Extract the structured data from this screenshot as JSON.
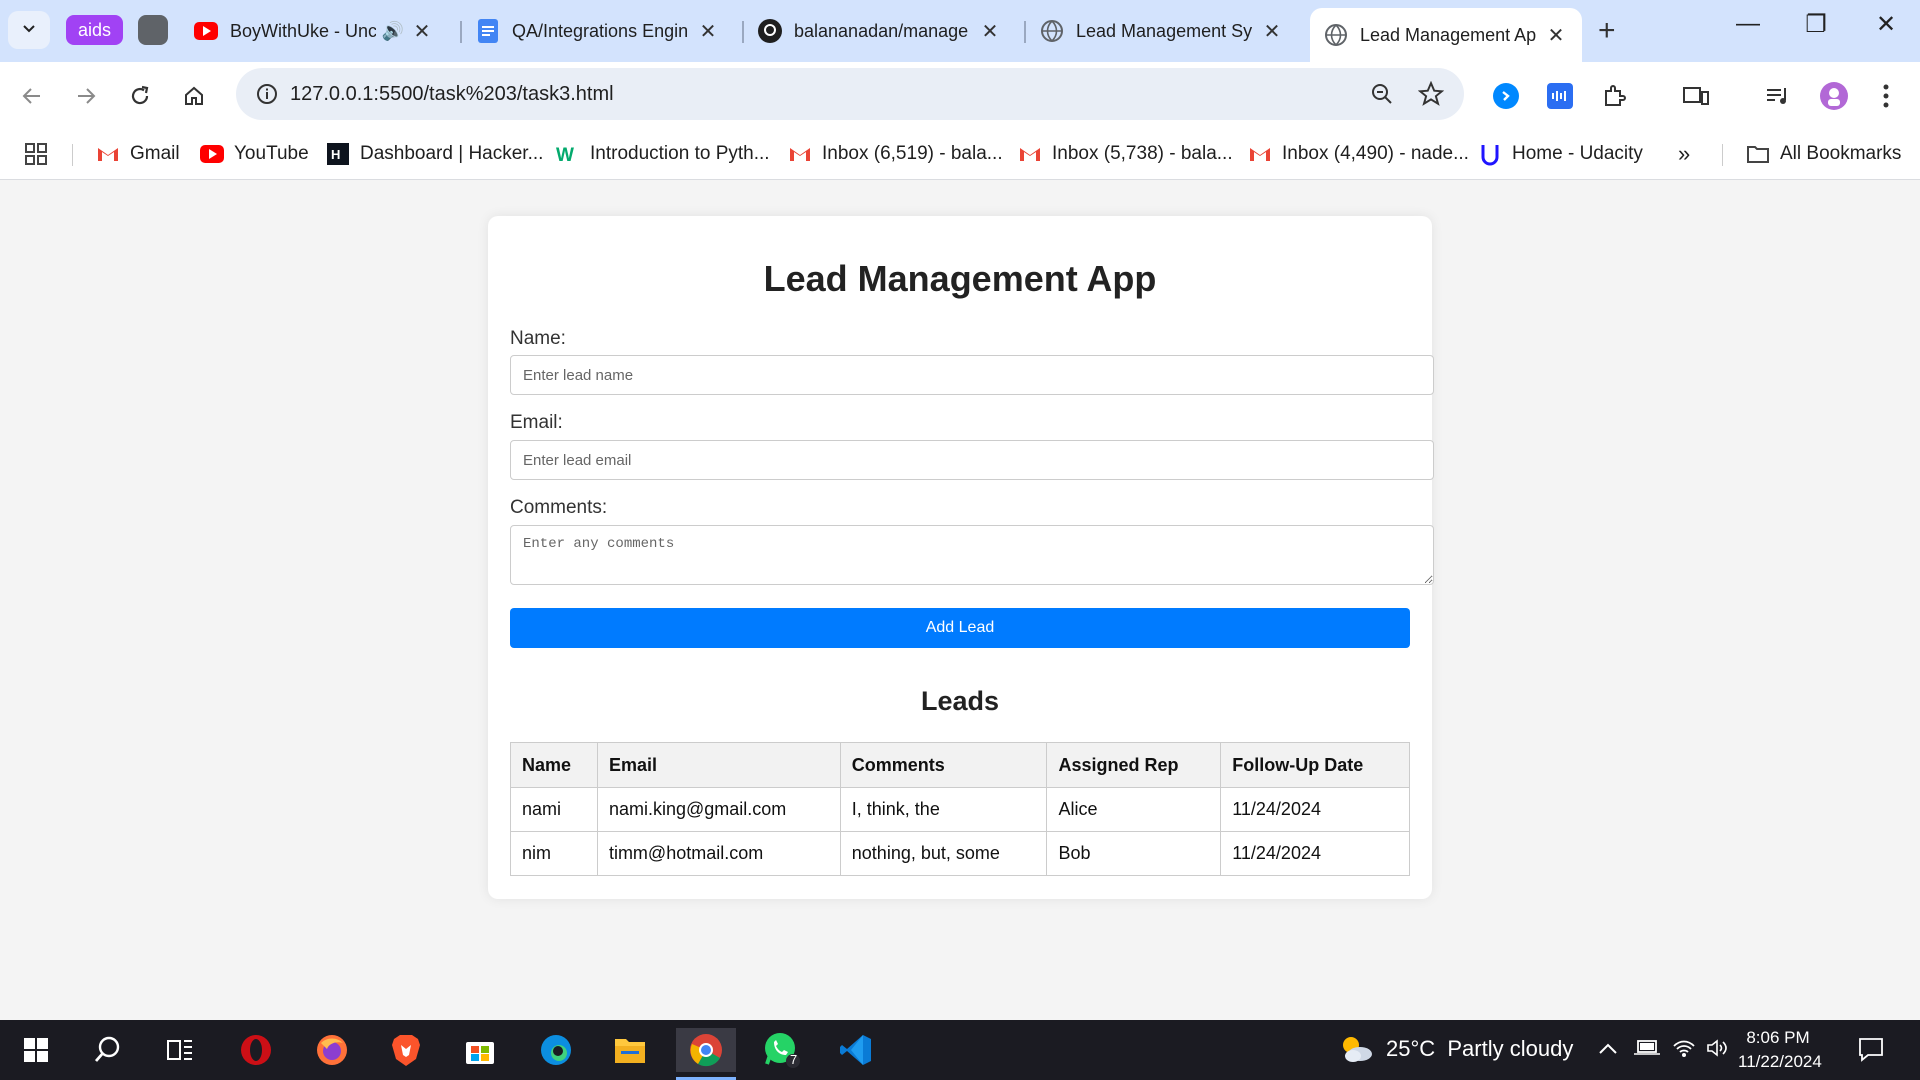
{
  "browser": {
    "tab_group_label": "aids",
    "tabs": [
      {
        "title": "BoyWithUke - Unc",
        "icon": "youtube-icon",
        "active": false
      },
      {
        "title": "QA/Integrations Engin",
        "icon": "docs-icon",
        "active": false
      },
      {
        "title": "balananadan/manage",
        "icon": "github-icon",
        "active": false
      },
      {
        "title": "Lead Management Sy",
        "icon": "globe-icon",
        "active": false
      },
      {
        "title": "Lead Management Ap",
        "icon": "globe-icon",
        "active": true
      }
    ],
    "url": "127.0.0.1:5500/task%203/task3.html",
    "bookmarks": [
      {
        "label": "Gmail",
        "icon": "gmail-icon"
      },
      {
        "label": "YouTube",
        "icon": "youtube-icon"
      },
      {
        "label": "Dashboard | Hacker...",
        "icon": "hackerrank-icon"
      },
      {
        "label": "Introduction to Pyth...",
        "icon": "w3-icon"
      },
      {
        "label": "Inbox (6,519) - bala...",
        "icon": "gmail-icon"
      },
      {
        "label": "Inbox (5,738) - bala...",
        "icon": "gmail-icon"
      },
      {
        "label": "Inbox (4,490) - nade...",
        "icon": "gmail-icon"
      },
      {
        "label": "Home - Udacity",
        "icon": "udacity-icon"
      }
    ],
    "all_bookmarks_label": "All Bookmarks"
  },
  "app": {
    "title": "Lead Management App",
    "name_label": "Name:",
    "name_placeholder": "Enter lead name",
    "email_label": "Email:",
    "email_placeholder": "Enter lead email",
    "comments_label": "Comments:",
    "comments_placeholder": "Enter any comments",
    "add_button": "Add Lead",
    "leads_heading": "Leads",
    "table_headers": [
      "Name",
      "Email",
      "Comments",
      "Assigned Rep",
      "Follow-Up Date"
    ],
    "rows": [
      [
        "nami",
        "nami.king@gmail.com",
        "I, think, the",
        "Alice",
        "11/24/2024"
      ],
      [
        "nim",
        "timm@hotmail.com",
        "nothing, but, some",
        "Bob",
        "11/24/2024"
      ]
    ],
    "accent_color": "#007bff"
  },
  "taskbar": {
    "weather": "25°C  Partly cloudy",
    "time": "8:06 PM",
    "date": "11/22/2024",
    "whatsapp_badge": "7"
  }
}
